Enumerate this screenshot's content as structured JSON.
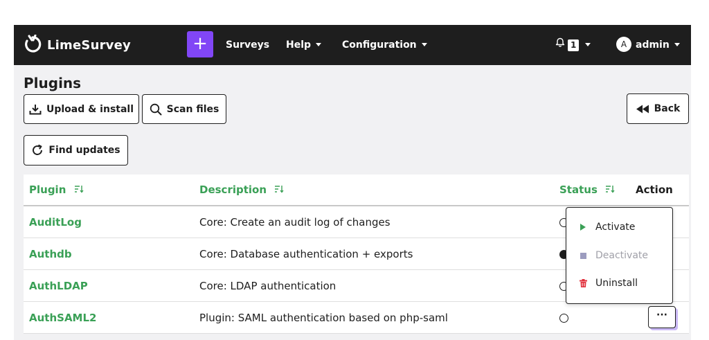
{
  "nav": {
    "brand": "LimeSurvey",
    "plus_label": "+",
    "surveys": "Surveys",
    "help": "Help",
    "configuration": "Configuration",
    "notification_count": "1",
    "avatar_initial": "A",
    "user": "admin"
  },
  "page": {
    "title": "Plugins",
    "upload_label": "Upload & install",
    "scan_label": "Scan files",
    "find_updates_label": "Find updates",
    "back_label": "Back"
  },
  "table": {
    "headers": {
      "plugin": "Plugin",
      "description": "Description",
      "status": "Status",
      "action": "Action"
    },
    "rows": [
      {
        "name": "AuditLog",
        "description": "Core: Create an audit log of changes",
        "status": "inactive"
      },
      {
        "name": "Authdb",
        "description": "Core: Database authentication + exports",
        "status": "active"
      },
      {
        "name": "AuthLDAP",
        "description": "Core: LDAP authentication",
        "status": "inactive"
      },
      {
        "name": "AuthSAML2",
        "description": "Plugin: SAML authentication based on php-saml",
        "status": "inactive"
      }
    ]
  },
  "action_button_label": "···",
  "dropdown": {
    "activate": "Activate",
    "deactivate": "Deactivate",
    "uninstall": "Uninstall"
  },
  "colors": {
    "nav_bg": "#1e1e1e",
    "accent_purple": "#8146f6",
    "link_green": "#3aa056",
    "content_bg": "#f1f1f3",
    "danger_red": "#e02e3a",
    "activate_green": "#3aa056"
  },
  "icons": {
    "logo": "limesurvey-logo-icon",
    "upload": "upload-icon",
    "scan": "search-icon",
    "refresh": "refresh-icon",
    "back": "backward-icon",
    "bell": "bell-icon",
    "sort": "sort-icon",
    "activate": "play-icon",
    "deactivate": "stop-icon",
    "uninstall": "trash-icon"
  }
}
